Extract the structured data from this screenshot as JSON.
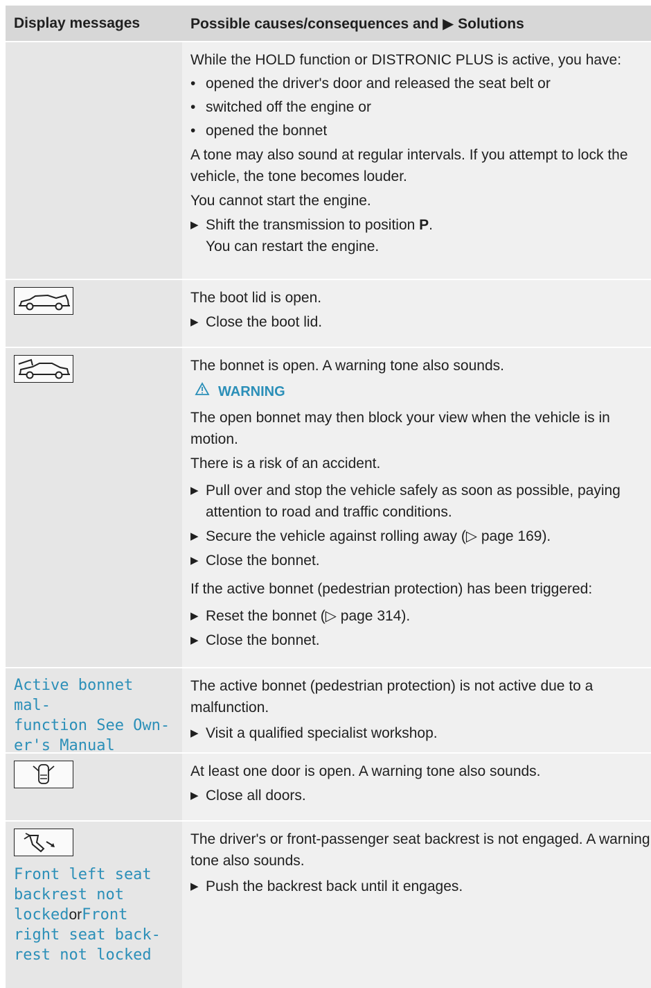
{
  "header": {
    "col1": "Display messages",
    "col2": "Possible causes/consequences and ▶ Solutions"
  },
  "row1": {
    "intro": "While the HOLD function or DISTRONIC PLUS is active, you have:",
    "bullets": [
      "opened the driver's door and released the seat belt or",
      "switched off the engine or",
      "opened the bonnet"
    ],
    "tone": "A tone may also sound at regular intervals. If you attempt to lock the vehicle, the tone becomes louder.",
    "nostart": "You cannot start the engine.",
    "step_pre": "Shift the transmission to position ",
    "step_bold": "P",
    "step_post": ".",
    "step_line2": "You can restart the engine."
  },
  "row2": {
    "icon": "boot-lid-open-icon",
    "text": "The boot lid is open.",
    "step": "Close the boot lid."
  },
  "row3": {
    "icon": "bonnet-open-icon",
    "text": "The bonnet is open. A warning tone also sounds.",
    "warning_label": "WARNING",
    "warning_text": "The open bonnet may then block your view when the vehicle is in motion.",
    "risk": "There is a risk of an accident.",
    "steps": [
      "Pull over and stop the vehicle safely as soon as possible, paying attention to road and traffic conditions.",
      "Secure the vehicle against rolling away (▷ page 169).",
      "Close the bonnet."
    ],
    "active_text": "If the active bonnet (pedestrian protection) has been triggered:",
    "steps2": [
      "Reset the bonnet (▷ page 314).",
      "Close the bonnet."
    ]
  },
  "row4": {
    "message": "Active bonnet mal-\nfunction See Own-\ner's Manual",
    "text": "The active bonnet (pedestrian protection) is not active due to a malfunction.",
    "step": "Visit a qualified specialist workshop."
  },
  "row5": {
    "icon": "door-open-icon",
    "text": "At least one door is open. A warning tone also sounds.",
    "step": "Close all doors."
  },
  "row6": {
    "icon": "seat-backrest-icon",
    "msg1": "Front left seat backrest not locked",
    "or": "or",
    "msg2": "Front right seat back-rest not locked",
    "text": "The driver's or front-passenger seat backrest is not engaged. A warning tone also sounds.",
    "step": "Push the backrest back until it engages."
  },
  "colors": {
    "accent": "#2b8fb8",
    "header_bg": "#d7d7d7",
    "left_bg": "#e6e6e6",
    "right_bg": "#f0f0f0"
  }
}
